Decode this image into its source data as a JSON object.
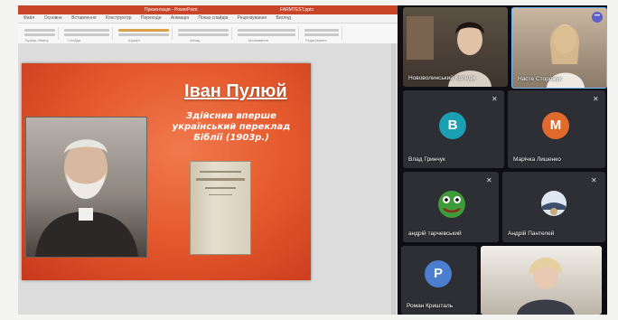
{
  "powerpoint": {
    "title": "Презентація - PowerPoint",
    "file_name": "FARMTEST.pptx",
    "tabs": [
      "Файл",
      "Основне",
      "Вставлення",
      "Конструктор",
      "Переходи",
      "Анімація",
      "Показ слайдів",
      "Рецензування",
      "Вигляд"
    ],
    "ribbon_groups": [
      "Буфер обміну",
      "Слайди",
      "Шрифт",
      "Абзац",
      "Малювання",
      "Редагування"
    ]
  },
  "slide": {
    "title": "Іван Пулюй",
    "subtitle": "Здійснив вперше український переклад Біблії (1903р.)"
  },
  "teams": {
    "participants": [
      {
        "name": "Нововолинський Коледж",
        "type": "video"
      },
      {
        "name": "Насте Сторожук",
        "type": "video",
        "active": true
      },
      {
        "name": "Влад Гринчук",
        "initial": "B",
        "color": "#1a9fb3"
      },
      {
        "name": "Марічка Лишенко",
        "initial": "M",
        "color": "#e06a2c"
      },
      {
        "name": "андрій тарчевський",
        "type": "avatar-image"
      },
      {
        "name": "Андрій Пантелей",
        "type": "avatar-image"
      },
      {
        "name": "Роман Кришталь",
        "initial": "P",
        "color": "#4c7ed0"
      },
      {
        "name": "",
        "type": "video"
      }
    ],
    "more_glyph": "•••"
  }
}
